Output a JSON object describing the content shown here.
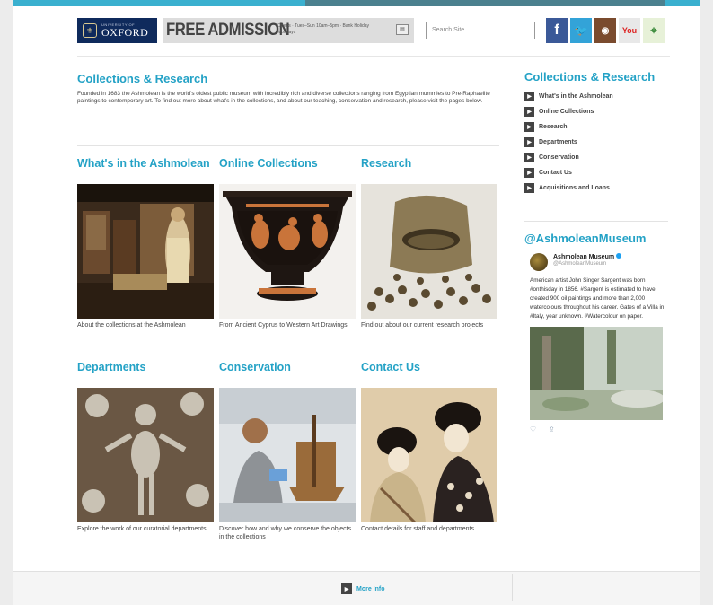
{
  "header": {
    "university_small": "UNIVERSITY OF",
    "university": "OXFORD",
    "admission": "FREE ADMISSION",
    "hours": "Opens · Tues–Sun 10am–5pm · Bank Holiday Mondays",
    "search_placeholder": "Search Site"
  },
  "social": [
    {
      "name": "facebook-icon",
      "glyph": "f"
    },
    {
      "name": "twitter-icon",
      "glyph": "t"
    },
    {
      "name": "instagram-icon",
      "glyph": "◉"
    },
    {
      "name": "youtube-icon",
      "glyph": "You"
    },
    {
      "name": "google-maps-icon",
      "glyph": "⌖"
    }
  ],
  "main": {
    "title": "Collections & Research",
    "intro": "Founded in 1683 the Ashmolean is the world's oldest public museum with incredibly rich and diverse collections ranging from Egyptian mummies to Pre-Raphaelite paintings to contemporary art. To find out more about what's in the collections, and about our teaching, conservation and research, please visit the pages below.",
    "cards": [
      {
        "title": "What's in the Ashmolean",
        "caption": "About the collections at the Ashmolean"
      },
      {
        "title": "Online Collections",
        "caption": "From Ancient Cyprus to Western Art Drawings"
      },
      {
        "title": "Research",
        "caption": "Find out about our current research projects"
      },
      {
        "title": "Departments",
        "caption": "Explore the work of our curatorial departments"
      },
      {
        "title": "Conservation",
        "caption": "Discover how and why we conserve the objects in the collections"
      },
      {
        "title": "Contact Us",
        "caption": "Contact details for staff and departments"
      }
    ]
  },
  "sidebar": {
    "title": "Collections & Research",
    "items": [
      "What's in the Ashmolean",
      "Online Collections",
      "Research",
      "Departments",
      "Conservation",
      "Contact Us",
      "Acquisitions and Loans"
    ]
  },
  "twitter": {
    "heading": "@AshmoleanMuseum",
    "name": "Ashmolean Museum",
    "handle": "@AshmoleanMuseum",
    "body": "American artist John Singer Sargent was born #onthisday in 1856. #Sargent is estimated to have created 900 oil paintings and more than 2,000 watercolours throughout his career. Gates of a Villa in #Italy, year unknown. #Watercolour on paper."
  },
  "footer": {
    "more": "More Info"
  }
}
